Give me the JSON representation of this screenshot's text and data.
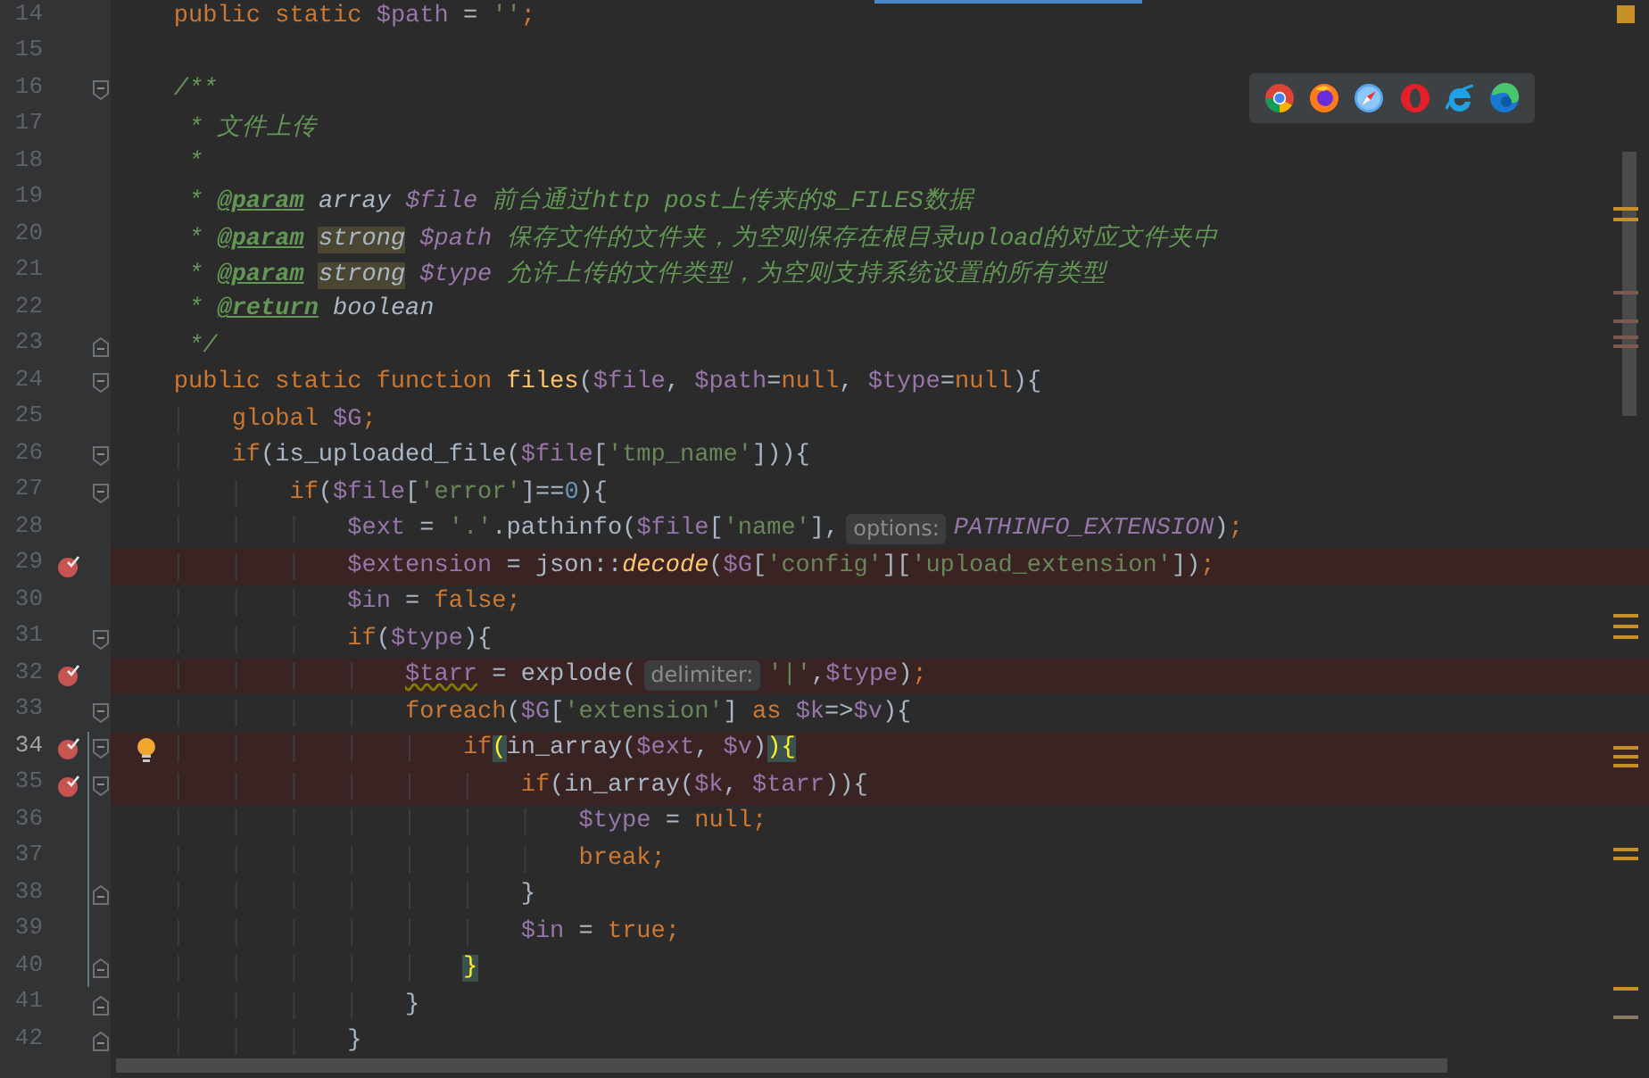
{
  "editor": {
    "lines": [
      {
        "number": "14",
        "breakpoint": false,
        "current": false,
        "changed": false,
        "intention": false,
        "fold_start": false,
        "fold_end": false,
        "tokens": [
          {
            "kind": "kw",
            "text": "    public static "
          },
          {
            "kind": "var",
            "text": "$path"
          },
          {
            "kind": "plain",
            "text": " = "
          },
          {
            "kind": "str",
            "text": "''"
          },
          {
            "kind": "kw",
            "text": ";"
          }
        ]
      },
      {
        "number": "15",
        "breakpoint": false,
        "current": false,
        "changed": false,
        "intention": false,
        "fold_start": false,
        "fold_end": false
      },
      {
        "number": "16",
        "breakpoint": false,
        "current": false,
        "changed": false,
        "intention": false,
        "fold_start": true,
        "fold_end": false,
        "tokens": [
          {
            "kind": "com",
            "text": "    /**"
          }
        ]
      },
      {
        "number": "17",
        "breakpoint": false,
        "current": false,
        "changed": false,
        "intention": false,
        "fold_start": false,
        "fold_end": false,
        "tokens": [
          {
            "kind": "com",
            "text": "     * 文件上传"
          }
        ]
      },
      {
        "number": "18",
        "breakpoint": false,
        "current": false,
        "changed": false,
        "intention": false,
        "fold_start": false,
        "fold_end": false,
        "tokens": [
          {
            "kind": "com",
            "text": "     *"
          }
        ]
      },
      {
        "number": "19",
        "breakpoint": false,
        "current": false,
        "changed": false,
        "intention": false,
        "fold_start": false,
        "fold_end": false,
        "tokens": [
          {
            "kind": "com",
            "text": "     * "
          },
          {
            "kind": "tag",
            "text": "@param "
          },
          {
            "kind": "type",
            "text": "array "
          },
          {
            "kind": "docvar",
            "text": "$file"
          },
          {
            "kind": "com",
            "text": " 前台通过http post上传来的$_FILES数据"
          }
        ]
      },
      {
        "number": "20",
        "breakpoint": false,
        "current": false,
        "changed": false,
        "intention": false,
        "fold_start": false,
        "fold_end": false,
        "tokens": [
          {
            "kind": "com",
            "text": "     * "
          },
          {
            "kind": "tag",
            "text": "@param "
          },
          {
            "kind": "unknowntype",
            "text": "strong "
          },
          {
            "kind": "docvar",
            "text": "$path"
          },
          {
            "kind": "com",
            "text": " 保存文件的文件夹，为空则保存在根目录upload的对应文件夹中"
          }
        ]
      },
      {
        "number": "21",
        "breakpoint": false,
        "current": false,
        "changed": false,
        "intention": false,
        "fold_start": false,
        "fold_end": false,
        "tokens": [
          {
            "kind": "com",
            "text": "     * "
          },
          {
            "kind": "tag",
            "text": "@param "
          },
          {
            "kind": "unknowntype",
            "text": "strong "
          },
          {
            "kind": "docvar",
            "text": "$type"
          },
          {
            "kind": "com",
            "text": " 允许上传的文件类型，为空则支持系统设置的所有类型"
          }
        ]
      },
      {
        "number": "22",
        "breakpoint": false,
        "current": false,
        "changed": false,
        "intention": false,
        "fold_start": false,
        "fold_end": false,
        "tokens": [
          {
            "kind": "com",
            "text": "     * "
          },
          {
            "kind": "tag",
            "text": "@return "
          },
          {
            "kind": "type",
            "text": "boolean"
          }
        ]
      },
      {
        "number": "23",
        "breakpoint": false,
        "current": false,
        "changed": false,
        "intention": false,
        "fold_start": false,
        "fold_end": true,
        "tokens": [
          {
            "kind": "com",
            "text": "     */"
          }
        ]
      },
      {
        "number": "24",
        "breakpoint": false,
        "current": false,
        "changed": false,
        "intention": false,
        "fold_start": true,
        "fold_end": false,
        "tokens": [
          {
            "kind": "kw",
            "text": "    public static function "
          },
          {
            "kind": "fndef",
            "text": "files"
          },
          {
            "kind": "plain",
            "text": "("
          },
          {
            "kind": "var",
            "text": "$file"
          },
          {
            "kind": "plain",
            "text": ", "
          },
          {
            "kind": "var",
            "text": "$path"
          },
          {
            "kind": "plain",
            "text": "="
          },
          {
            "kind": "kw",
            "text": "null"
          },
          {
            "kind": "plain",
            "text": ", "
          },
          {
            "kind": "var",
            "text": "$type"
          },
          {
            "kind": "plain",
            "text": "="
          },
          {
            "kind": "kw",
            "text": "null"
          },
          {
            "kind": "plain",
            "text": "){"
          }
        ]
      },
      {
        "number": "25",
        "breakpoint": false,
        "current": false,
        "changed": false,
        "intention": false,
        "fold_start": false,
        "fold_end": false,
        "tokens": [
          {
            "kind": "kw",
            "text": "        global "
          },
          {
            "kind": "var",
            "text": "$G"
          },
          {
            "kind": "kw",
            "text": ";"
          }
        ]
      },
      {
        "number": "26",
        "breakpoint": false,
        "current": false,
        "changed": false,
        "intention": false,
        "fold_start": true,
        "fold_end": false,
        "tokens": [
          {
            "kind": "kw",
            "text": "        if"
          },
          {
            "kind": "plain",
            "text": "(is_uploaded_file("
          },
          {
            "kind": "var",
            "text": "$file"
          },
          {
            "kind": "plain",
            "text": "["
          },
          {
            "kind": "str",
            "text": "'tmp_name'"
          },
          {
            "kind": "plain",
            "text": "])){"
          }
        ]
      },
      {
        "number": "27",
        "breakpoint": false,
        "current": false,
        "changed": false,
        "intention": false,
        "fold_start": true,
        "fold_end": false,
        "tokens": [
          {
            "kind": "kw",
            "text": "            if"
          },
          {
            "kind": "plain",
            "text": "("
          },
          {
            "kind": "var",
            "text": "$file"
          },
          {
            "kind": "plain",
            "text": "["
          },
          {
            "kind": "str",
            "text": "'error'"
          },
          {
            "kind": "plain",
            "text": "]=="
          },
          {
            "kind": "num",
            "text": "0"
          },
          {
            "kind": "plain",
            "text": "){"
          }
        ]
      },
      {
        "number": "28",
        "breakpoint": false,
        "current": false,
        "changed": false,
        "intention": false,
        "fold_start": false,
        "fold_end": false,
        "tokens": [
          {
            "kind": "var",
            "text": "                $ext"
          },
          {
            "kind": "plain",
            "text": " = "
          },
          {
            "kind": "str",
            "text": "'.'"
          },
          {
            "kind": "plain",
            "text": ".pathinfo("
          },
          {
            "kind": "var",
            "text": "$file"
          },
          {
            "kind": "plain",
            "text": "["
          },
          {
            "kind": "str",
            "text": "'name'"
          },
          {
            "kind": "plain",
            "text": "],"
          },
          {
            "kind": "hint",
            "text": "options:"
          },
          {
            "kind": "const",
            "text": "PATHINFO_EXTENSION"
          },
          {
            "kind": "plain",
            "text": ")"
          },
          {
            "kind": "kw",
            "text": ";"
          }
        ]
      },
      {
        "number": "29",
        "breakpoint": true,
        "current": false,
        "changed": false,
        "intention": false,
        "fold_start": false,
        "fold_end": false,
        "tokens": [
          {
            "kind": "var",
            "text": "                $extension"
          },
          {
            "kind": "plain",
            "text": " = json::"
          },
          {
            "kind": "static",
            "text": "decode"
          },
          {
            "kind": "plain",
            "text": "("
          },
          {
            "kind": "var",
            "text": "$G"
          },
          {
            "kind": "plain",
            "text": "["
          },
          {
            "kind": "str",
            "text": "'config'"
          },
          {
            "kind": "plain",
            "text": "]["
          },
          {
            "kind": "str",
            "text": "'upload_extension'"
          },
          {
            "kind": "plain",
            "text": "])"
          },
          {
            "kind": "kw",
            "text": ";"
          }
        ]
      },
      {
        "number": "30",
        "breakpoint": false,
        "current": false,
        "changed": false,
        "intention": false,
        "fold_start": false,
        "fold_end": false,
        "tokens": [
          {
            "kind": "var",
            "text": "                $in"
          },
          {
            "kind": "plain",
            "text": " = "
          },
          {
            "kind": "kw",
            "text": "false;"
          }
        ]
      },
      {
        "number": "31",
        "breakpoint": false,
        "current": false,
        "changed": false,
        "intention": false,
        "fold_start": true,
        "fold_end": false,
        "tokens": [
          {
            "kind": "kw",
            "text": "                if"
          },
          {
            "kind": "plain",
            "text": "("
          },
          {
            "kind": "var",
            "text": "$type"
          },
          {
            "kind": "plain",
            "text": "){"
          }
        ]
      },
      {
        "number": "32",
        "breakpoint": true,
        "current": false,
        "changed": false,
        "intention": false,
        "fold_start": false,
        "fold_end": false,
        "tokens": [
          {
            "kind": "warnvar",
            "text": "                    $tarr"
          },
          {
            "kind": "plain",
            "text": " = explode("
          },
          {
            "kind": "hint",
            "text": "delimiter:"
          },
          {
            "kind": "str",
            "text": "'|'"
          },
          {
            "kind": "plain",
            "text": ","
          },
          {
            "kind": "var",
            "text": "$type"
          },
          {
            "kind": "plain",
            "text": ")"
          },
          {
            "kind": "kw",
            "text": ";"
          }
        ]
      },
      {
        "number": "33",
        "breakpoint": false,
        "current": false,
        "changed": false,
        "intention": false,
        "fold_start": true,
        "fold_end": false,
        "tokens": [
          {
            "kind": "kw",
            "text": "                    foreach"
          },
          {
            "kind": "plain",
            "text": "("
          },
          {
            "kind": "var",
            "text": "$G"
          },
          {
            "kind": "plain",
            "text": "["
          },
          {
            "kind": "str",
            "text": "'extension'"
          },
          {
            "kind": "plain",
            "text": "] "
          },
          {
            "kind": "kw",
            "text": "as "
          },
          {
            "kind": "var",
            "text": "$k"
          },
          {
            "kind": "plain",
            "text": "=>"
          },
          {
            "kind": "var",
            "text": "$v"
          },
          {
            "kind": "plain",
            "text": "){"
          }
        ]
      },
      {
        "number": "34",
        "breakpoint": true,
        "current": true,
        "changed": true,
        "intention": true,
        "fold_start": true,
        "fold_end": false,
        "tokens": [
          {
            "kind": "kw",
            "text": "                        if"
          },
          {
            "kind": "match",
            "text": "("
          },
          {
            "kind": "plain",
            "text": "in_array("
          },
          {
            "kind": "var",
            "text": "$ext"
          },
          {
            "kind": "plain",
            "text": ", "
          },
          {
            "kind": "var",
            "text": "$v"
          },
          {
            "kind": "plain",
            "text": ")"
          },
          {
            "kind": "match",
            "text": ")"
          },
          {
            "kind": "match",
            "text": "{"
          }
        ]
      },
      {
        "number": "35",
        "breakpoint": true,
        "current": false,
        "changed": true,
        "intention": false,
        "fold_start": true,
        "fold_end": false,
        "tokens": [
          {
            "kind": "kw",
            "text": "                            if"
          },
          {
            "kind": "plain",
            "text": "(in_array("
          },
          {
            "kind": "var",
            "text": "$k"
          },
          {
            "kind": "plain",
            "text": ", "
          },
          {
            "kind": "var",
            "text": "$tarr"
          },
          {
            "kind": "plain",
            "text": ")){"
          }
        ]
      },
      {
        "number": "36",
        "breakpoint": false,
        "current": false,
        "changed": true,
        "intention": false,
        "fold_start": false,
        "fold_end": false,
        "tokens": [
          {
            "kind": "var",
            "text": "                                $type"
          },
          {
            "kind": "plain",
            "text": " = "
          },
          {
            "kind": "kw",
            "text": "null;"
          }
        ]
      },
      {
        "number": "37",
        "breakpoint": false,
        "current": false,
        "changed": true,
        "intention": false,
        "fold_start": false,
        "fold_end": false,
        "tokens": [
          {
            "kind": "kw",
            "text": "                                break;"
          }
        ]
      },
      {
        "number": "38",
        "breakpoint": false,
        "current": false,
        "changed": true,
        "intention": false,
        "fold_start": false,
        "fold_end": true,
        "tokens": [
          {
            "kind": "plain",
            "text": "                            }"
          }
        ]
      },
      {
        "number": "39",
        "breakpoint": false,
        "current": false,
        "changed": true,
        "intention": false,
        "fold_start": false,
        "fold_end": false,
        "tokens": [
          {
            "kind": "var",
            "text": "                            $in"
          },
          {
            "kind": "plain",
            "text": " = "
          },
          {
            "kind": "kw",
            "text": "true;"
          }
        ]
      },
      {
        "number": "40",
        "breakpoint": false,
        "current": false,
        "changed": true,
        "intention": false,
        "fold_start": false,
        "fold_end": true,
        "tokens": [
          {
            "kind": "match",
            "text": "                        }"
          }
        ]
      },
      {
        "number": "41",
        "breakpoint": false,
        "current": false,
        "changed": false,
        "intention": false,
        "fold_start": false,
        "fold_end": true,
        "tokens": [
          {
            "kind": "plain",
            "text": "                    }"
          }
        ]
      },
      {
        "number": "42",
        "breakpoint": false,
        "current": false,
        "changed": false,
        "intention": false,
        "fold_start": false,
        "fold_end": true,
        "tokens": [
          {
            "kind": "plain",
            "text": "                }"
          }
        ]
      }
    ]
  },
  "browser_bar": {
    "items": [
      {
        "kind": "chrome"
      },
      {
        "kind": "firefox"
      },
      {
        "kind": "safari"
      },
      {
        "kind": "opera"
      },
      {
        "kind": "ie"
      },
      {
        "kind": "edge"
      }
    ]
  }
}
